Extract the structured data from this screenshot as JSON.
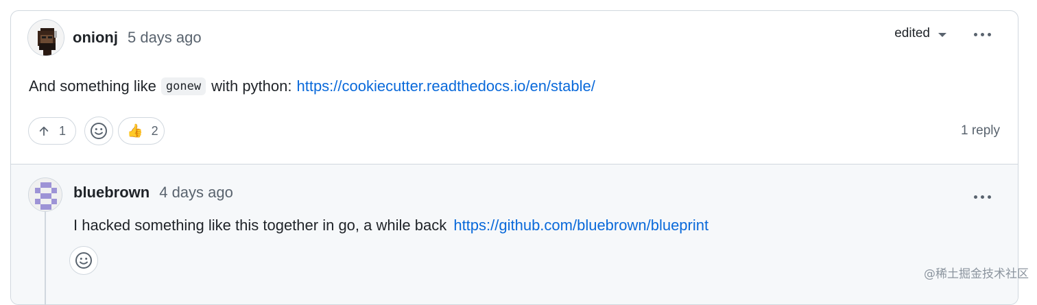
{
  "comment": {
    "author": "onionj",
    "timestamp": "5 days ago",
    "edited_label": "edited",
    "text_before": "And something like",
    "code": "gonew",
    "text_after": "with python:",
    "link": "https://cookiecutter.readthedocs.io/en/stable/",
    "reactions": {
      "upvote_count": "1",
      "thumbs_emoji": "👍",
      "thumbs_count": "2"
    },
    "reply_count": "1 reply"
  },
  "reply": {
    "author": "bluebrown",
    "timestamp": "4 days ago",
    "text": "I hacked something like this together in go, a while back",
    "link": "https://github.com/bluebrown/blueprint"
  },
  "watermark": "@稀土掘金技术社区",
  "icons": {
    "upvote": "arrow-up-icon",
    "add_reaction": "smiley-icon",
    "menu": "kebab-horizontal-icon",
    "dropdown": "triangle-down-icon"
  },
  "colors": {
    "link": "#0969da",
    "muted": "#59636e",
    "border": "#d0d7de",
    "reply_bg": "#f6f8fa"
  }
}
